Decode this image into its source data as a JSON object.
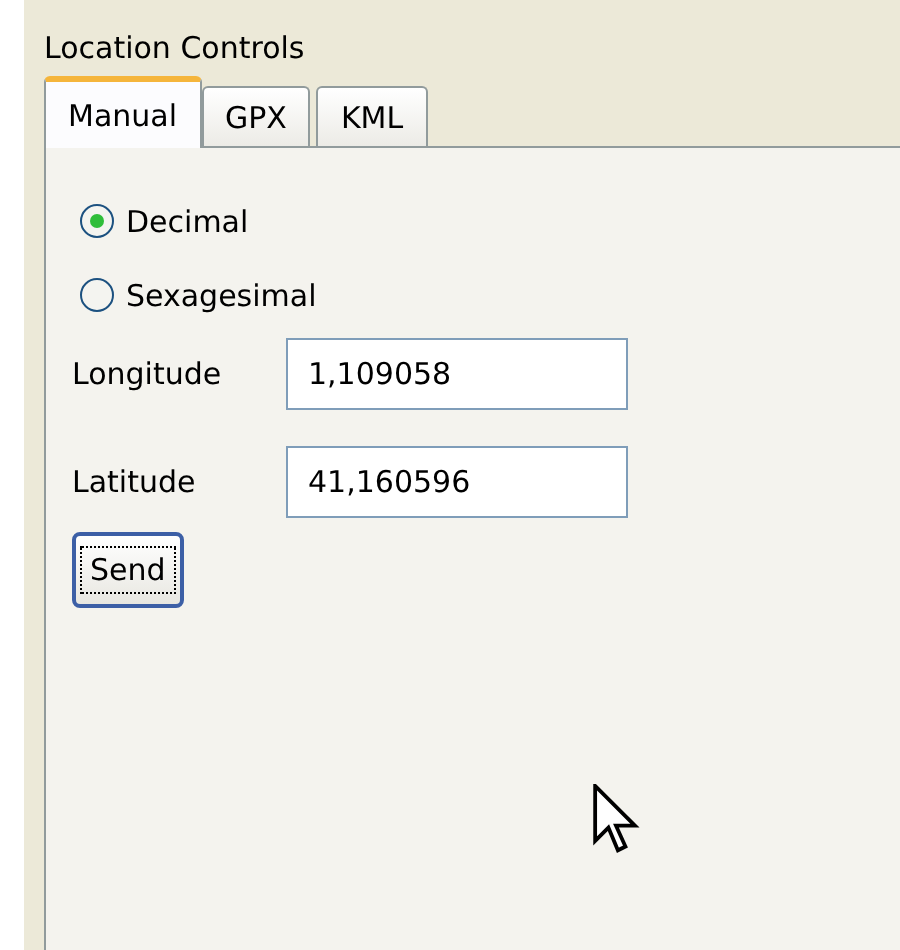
{
  "panel": {
    "title": "Location Controls"
  },
  "tabs": [
    {
      "label": "Manual",
      "selected": true
    },
    {
      "label": "GPX",
      "selected": false
    },
    {
      "label": "KML",
      "selected": false
    }
  ],
  "format_options": [
    {
      "label": "Decimal",
      "selected": true
    },
    {
      "label": "Sexagesimal",
      "selected": false
    }
  ],
  "fields": [
    {
      "label": "Longitude",
      "value": "1,109058"
    },
    {
      "label": "Latitude",
      "value": "41,160596"
    }
  ],
  "buttons": [
    {
      "label": "Send",
      "focused": true
    }
  ]
}
